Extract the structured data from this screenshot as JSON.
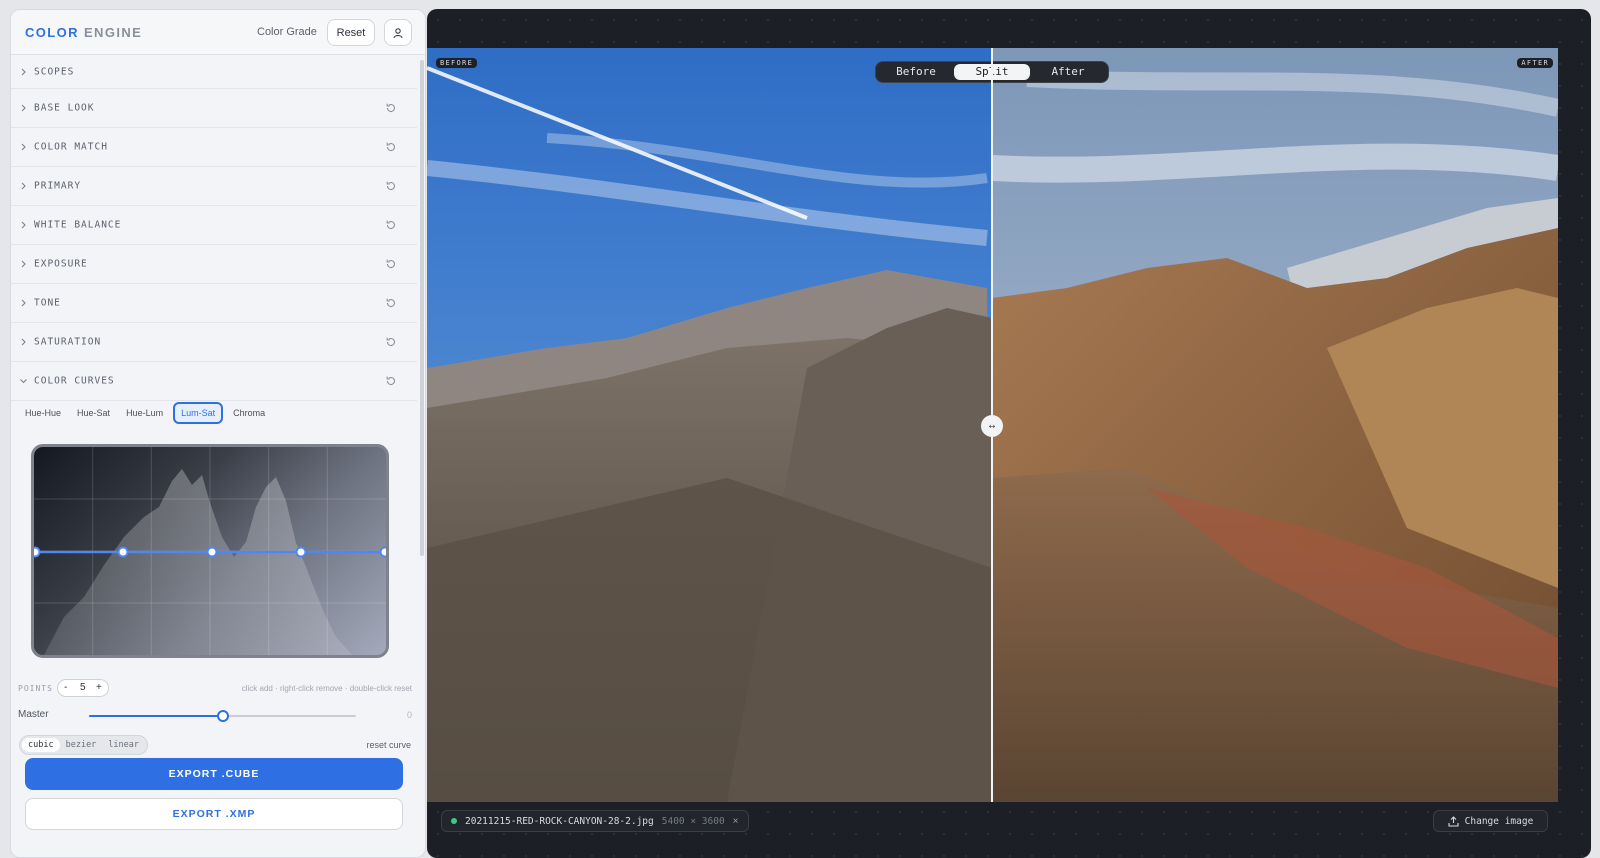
{
  "header": {
    "brand_primary": "COLOR",
    "brand_secondary": "ENGINE",
    "mode_label": "Color Grade",
    "reset_label": "Reset",
    "user_icon": "user-icon"
  },
  "sections": [
    {
      "label": "SCOPES",
      "expanded": false,
      "has_reset": false
    },
    {
      "label": "BASE LOOK",
      "expanded": false,
      "has_reset": true
    },
    {
      "label": "COLOR MATCH",
      "expanded": false,
      "has_reset": true
    },
    {
      "label": "PRIMARY",
      "expanded": false,
      "has_reset": true
    },
    {
      "label": "WHITE BALANCE",
      "expanded": false,
      "has_reset": true
    },
    {
      "label": "EXPOSURE",
      "expanded": false,
      "has_reset": true
    },
    {
      "label": "TONE",
      "expanded": false,
      "has_reset": true
    },
    {
      "label": "SATURATION",
      "expanded": false,
      "has_reset": true
    },
    {
      "label": "COLOR CURVES",
      "expanded": true,
      "has_reset": true
    }
  ],
  "curves": {
    "tabs": [
      "Hue-Hue",
      "Hue-Sat",
      "Hue-Lum",
      "Lum-Sat",
      "Chroma"
    ],
    "active_tab": "Lum-Sat",
    "points_label": "POINTS",
    "points_minus": "-",
    "points_value": "5",
    "points_plus": "+",
    "hint": "click add · right-click remove · double-click reset",
    "master_label": "Master",
    "master_value": "0",
    "master_fraction": 0.5,
    "interpolation": [
      "cubic",
      "bezier",
      "linear"
    ],
    "interpolation_active": "cubic",
    "reset_curve_label": "reset curve"
  },
  "export": {
    "cube_label": "EXPORT .CUBE",
    "xmp_label": "EXPORT .XMP"
  },
  "viewer": {
    "before_tag": "BEFORE",
    "after_tag": "AFTER",
    "modes": [
      "Before",
      "Split",
      "After"
    ],
    "active_mode": "Split",
    "split_handle_glyph": "↔",
    "file_name": "20211215-RED-ROCK-CANYON-28-2.jpg",
    "file_dims": "5400 × 3600",
    "close_glyph": "×",
    "change_image_label": "Change image"
  },
  "colors": {
    "accent": "#2f6fe4",
    "viewer_bg": "#1c1f25",
    "status_ok": "#3ec98a"
  }
}
